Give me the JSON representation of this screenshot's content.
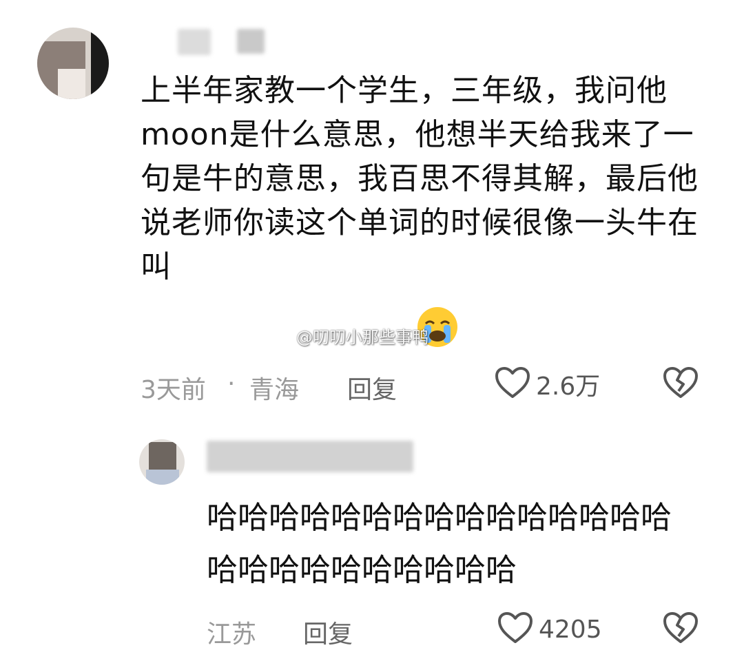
{
  "comment1": {
    "text": "上半年家教一个学生，三年级，我问他moon是什么意思，他想半天给我来了一句是牛的意思，我百思不得其解，最后他说老师你读这个单词的时候很像一头牛在叫",
    "emoji": "loudly-crying-face",
    "time": "3天前",
    "separator": "·",
    "location": "青海",
    "reply_label": "回复",
    "likes": "2.6万"
  },
  "comment2": {
    "text": "哈哈哈哈哈哈哈哈哈哈哈哈哈哈哈哈哈哈哈哈哈哈哈哈哈",
    "location": "江苏",
    "reply_label": "回复",
    "likes": "4205"
  },
  "watermark": "@叨叨小那些事鸭",
  "icons": {
    "like": "heart-outline-icon",
    "dislike": "broken-heart-icon"
  },
  "colors": {
    "text": "#111111",
    "meta": "#999999",
    "icon": "#555555"
  }
}
